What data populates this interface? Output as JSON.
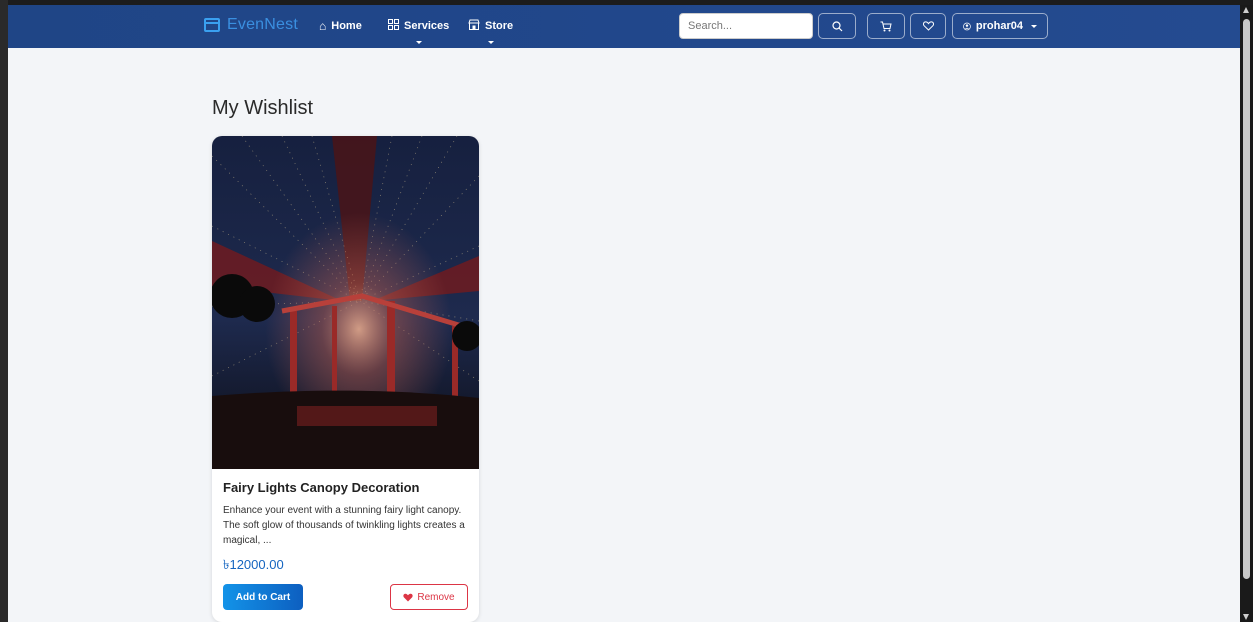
{
  "brand": {
    "name": "EvenNest",
    "accent": "#3a8fe0"
  },
  "nav": {
    "home": {
      "icon": "home-icon",
      "label": "Home"
    },
    "services": {
      "icon": "grid-icon",
      "label": "Services"
    },
    "store": {
      "icon": "store-icon",
      "label": "Store"
    }
  },
  "search": {
    "placeholder": "Search..."
  },
  "user": {
    "name": "prohar04"
  },
  "page": {
    "title": "My Wishlist"
  },
  "wishlist": [
    {
      "title": "Fairy Lights Canopy Decoration",
      "description": "Enhance your event with a stunning fairy light canopy. The soft glow of thousands of twinkling lights creates a magical, ...",
      "price": "৳12000.00",
      "add_label": "Add to Cart",
      "remove_label": "Remove"
    }
  ],
  "colors": {
    "navbar": "#21478b",
    "price": "#1565c0",
    "danger": "#dc3545",
    "primary": "#0d6efd"
  }
}
